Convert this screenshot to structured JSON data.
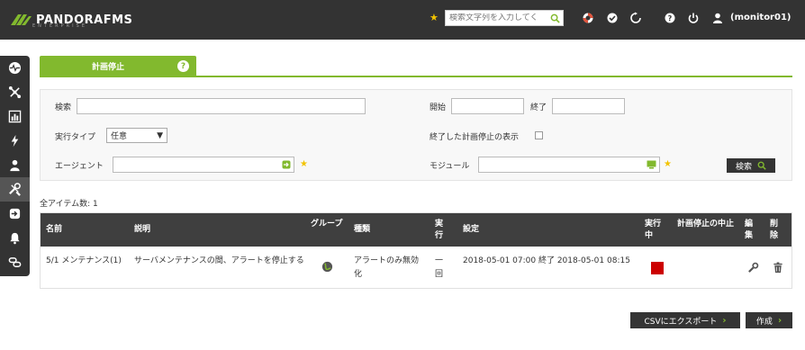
{
  "header": {
    "logo_text": "PANDORAFMS",
    "logo_sub": "ENTERPRISE",
    "search_placeholder": "検索文字列を入力してく",
    "user": "(monitor01)",
    "icons": [
      "star-icon",
      "search-icon",
      "lifebuoy-icon",
      "check-circle-icon",
      "refresh-icon",
      "help-icon",
      "power-icon",
      "user-icon"
    ]
  },
  "sidebar": {
    "items": [
      {
        "name": "monitoring",
        "icon": "pulse-icon"
      },
      {
        "name": "network",
        "icon": "network-icon"
      },
      {
        "name": "reports",
        "icon": "chart-icon"
      },
      {
        "name": "events",
        "icon": "bolt-icon"
      },
      {
        "name": "users",
        "icon": "users-icon"
      },
      {
        "name": "tools",
        "icon": "tools-icon",
        "active": true
      },
      {
        "name": "extensions",
        "icon": "login-icon"
      },
      {
        "name": "alerts",
        "icon": "bell-icon"
      },
      {
        "name": "links",
        "icon": "link-icon"
      }
    ]
  },
  "tab": {
    "label": "計画停止"
  },
  "filter": {
    "search_label": "検索",
    "search_value": "",
    "start_label": "開始",
    "start_value": "",
    "end_label": "終了",
    "end_value": "",
    "type_label": "実行タイプ",
    "type_value": "任意",
    "show_finished_label": "終了した計画停止の表示",
    "agent_label": "エージェント",
    "agent_value": "",
    "module_label": "モジュール",
    "module_value": "",
    "search_button": "検索"
  },
  "total_items": "全アイテム数: 1",
  "table": {
    "headers": {
      "name": "名前",
      "description": "説明",
      "group": "グループ",
      "type": "種類",
      "execution": "実行",
      "config": "設定",
      "running": "実行中",
      "stop_in": "計画停止の中止",
      "edit": "編集",
      "delete": "削除"
    },
    "rows": [
      {
        "name": "5/1 メンテナンス(1)",
        "description": "サーバメンテナンスの間、アラートを停止する",
        "type": "アラートのみ無効化",
        "execution": "一回",
        "config": "2018-05-01 07:00 終了 2018-05-01 08:15",
        "running_color": "#cc0000"
      }
    ]
  },
  "buttons": {
    "csv_export": "CSVにエクスポート",
    "create": "作成"
  },
  "colors": {
    "accent": "#82b92e",
    "dark": "#333333",
    "star": "#f2c300"
  }
}
